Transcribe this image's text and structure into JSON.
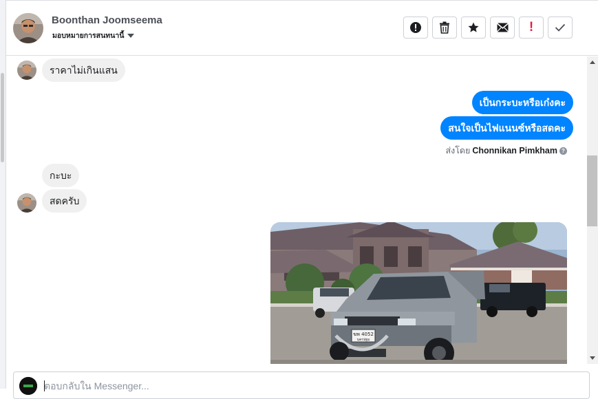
{
  "header": {
    "contact_name": "Boonthan Joomseema",
    "assign_label": "มอบหมายการสนทนานี้"
  },
  "actions": {
    "spam": "!",
    "delete": "trash-icon",
    "star": "star-icon",
    "mail": "mail-icon",
    "important": "!",
    "done": "check-icon"
  },
  "messages": [
    {
      "dir": "in",
      "text": "ราคาไม่เกินแสน"
    },
    {
      "dir": "out",
      "text": "เป็นกระบะหรือเก๋งคะ"
    },
    {
      "dir": "out",
      "text": "สนใจเป็นไฟแนนซ์หรือสดคะ"
    },
    {
      "dir": "in",
      "text": "กะบะ"
    },
    {
      "dir": "in",
      "text": "สดครับ"
    }
  ],
  "sent_by": {
    "prefix": "ส่งโดย",
    "name": "Chonnikan Pimkham",
    "help": "?"
  },
  "photo": {
    "plate_line1": "ฆพ 4052",
    "plate_line2": "นครปฐม"
  },
  "composer": {
    "placeholder": "ตอบกลับใน Messenger..."
  },
  "colors": {
    "accent": "#0084ff",
    "incoming_bubble": "#f0f0f0",
    "important": "#e41e3f"
  }
}
